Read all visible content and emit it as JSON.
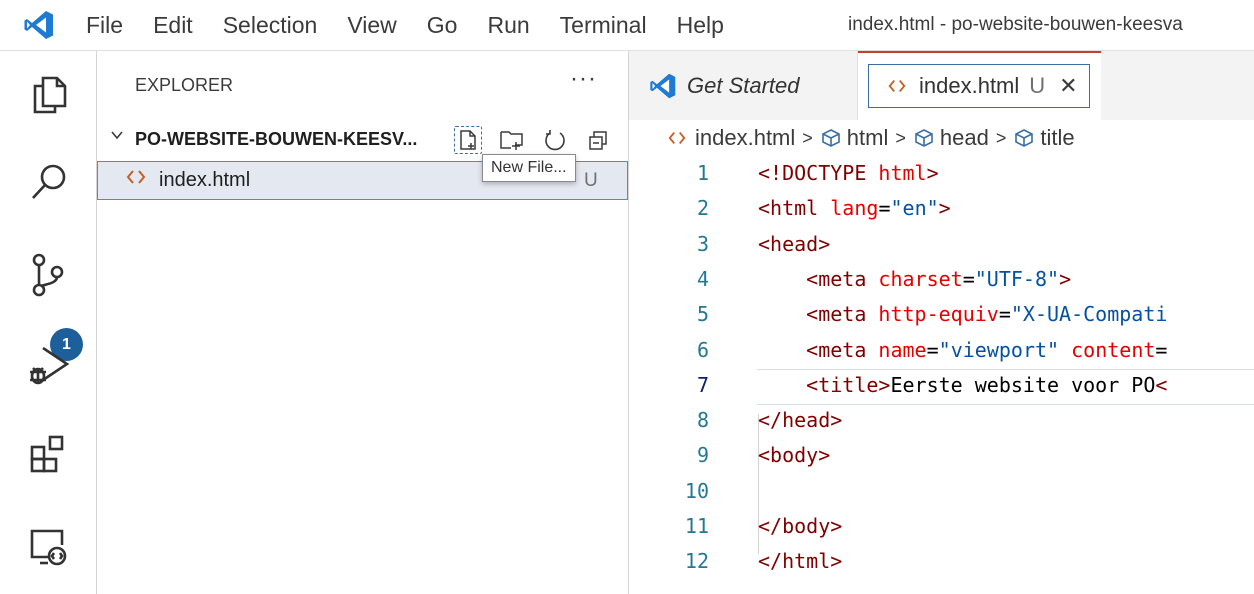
{
  "titlebar": {
    "menu": [
      "File",
      "Edit",
      "Selection",
      "View",
      "Go",
      "Run",
      "Terminal",
      "Help"
    ],
    "window_title": "index.html - po-website-bouwen-keesva"
  },
  "activity_bar": {
    "items": [
      "explorer-icon",
      "search-icon",
      "source-control-icon",
      "run-debug-icon",
      "extensions-icon",
      "remote-explorer-icon"
    ],
    "source_control_badge": "1"
  },
  "sidebar": {
    "title": "EXPLORER",
    "more_label": "···",
    "folder": {
      "name": "PO-WEBSITE-BOUWEN-KEESV...",
      "actions": [
        "new-file-icon",
        "new-folder-icon",
        "refresh-icon",
        "collapse-all-icon"
      ]
    },
    "files": [
      {
        "name": "index.html",
        "status": "U"
      }
    ],
    "tooltip": "New File..."
  },
  "tabs": {
    "get_started": "Get Started",
    "active": {
      "label": "index.html",
      "status": "U",
      "close": "✕"
    }
  },
  "breadcrumbs": [
    "index.html",
    "html",
    "head",
    "title"
  ],
  "editor": {
    "lines": [
      {
        "n": "1",
        "text": "<!DOCTYPE html>"
      },
      {
        "n": "2",
        "text": "<html lang=\"en\">"
      },
      {
        "n": "3",
        "text": "<head>"
      },
      {
        "n": "4",
        "text": "    <meta charset=\"UTF-8\">"
      },
      {
        "n": "5",
        "text": "    <meta http-equiv=\"X-UA-Compati"
      },
      {
        "n": "6",
        "text": "    <meta name=\"viewport\" content="
      },
      {
        "n": "7",
        "text": "    <title>Eerste website voor PO<"
      },
      {
        "n": "8",
        "text": "</head>"
      },
      {
        "n": "9",
        "text": "<body>"
      },
      {
        "n": "10",
        "text": ""
      },
      {
        "n": "11",
        "text": "</body>"
      },
      {
        "n": "12",
        "text": "</html>"
      }
    ],
    "active_line": "7"
  },
  "colors": {
    "accent": "#1c5f9b",
    "tab_active_border": "#c3402e",
    "tag": "#800000",
    "attribute": "#e50000",
    "string": "#0451a5",
    "line_number": "#237893"
  }
}
